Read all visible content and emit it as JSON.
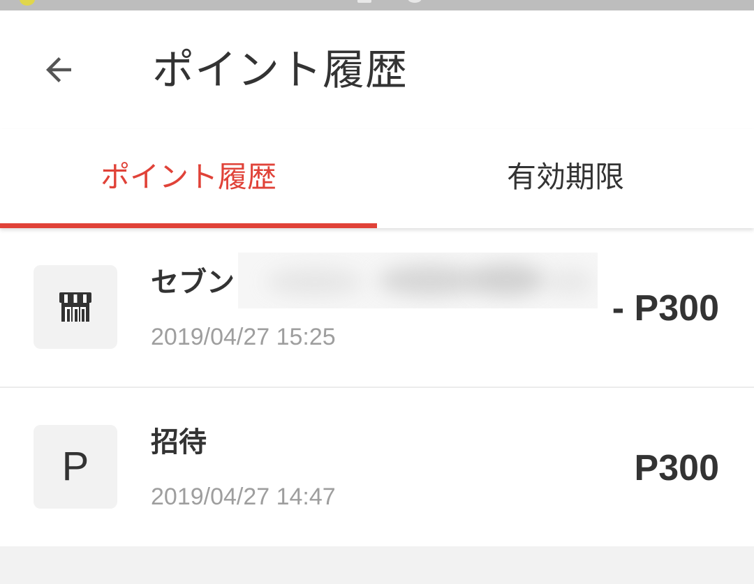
{
  "header": {
    "title": "ポイント履歴",
    "back_icon": "arrow-left-icon"
  },
  "tabs": [
    {
      "label": "ポイント履歴",
      "active": true
    },
    {
      "label": "有効期限",
      "active": false
    }
  ],
  "colors": {
    "accent": "#e04238",
    "text_primary": "#333333",
    "text_secondary": "#9e9e9e",
    "icon_box_bg": "#f2f2f2"
  },
  "history": [
    {
      "icon": "store-icon",
      "title": "セブン",
      "title_redacted": true,
      "date": "2019/04/27 15:25",
      "amount": "- P300"
    },
    {
      "icon": "point-p-icon",
      "icon_letter": "P",
      "title": "招待",
      "date": "2019/04/27 14:47",
      "amount": "P300"
    }
  ]
}
